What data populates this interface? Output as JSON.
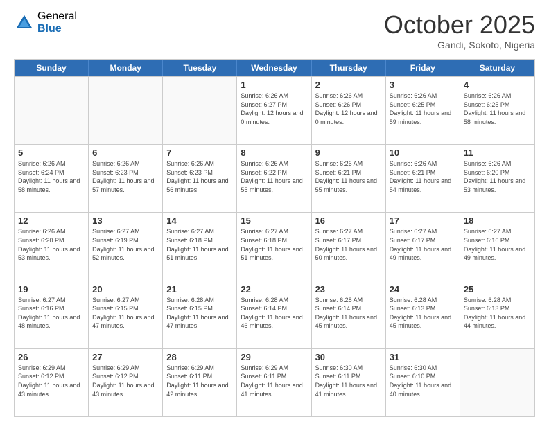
{
  "logo": {
    "general": "General",
    "blue": "Blue"
  },
  "header": {
    "month": "October 2025",
    "location": "Gandi, Sokoto, Nigeria"
  },
  "weekdays": [
    "Sunday",
    "Monday",
    "Tuesday",
    "Wednesday",
    "Thursday",
    "Friday",
    "Saturday"
  ],
  "weeks": [
    [
      {
        "day": "",
        "sunrise": "",
        "sunset": "",
        "daylight": "",
        "empty": true
      },
      {
        "day": "",
        "sunrise": "",
        "sunset": "",
        "daylight": "",
        "empty": true
      },
      {
        "day": "",
        "sunrise": "",
        "sunset": "",
        "daylight": "",
        "empty": true
      },
      {
        "day": "1",
        "sunrise": "Sunrise: 6:26 AM",
        "sunset": "Sunset: 6:27 PM",
        "daylight": "Daylight: 12 hours and 0 minutes."
      },
      {
        "day": "2",
        "sunrise": "Sunrise: 6:26 AM",
        "sunset": "Sunset: 6:26 PM",
        "daylight": "Daylight: 12 hours and 0 minutes."
      },
      {
        "day": "3",
        "sunrise": "Sunrise: 6:26 AM",
        "sunset": "Sunset: 6:25 PM",
        "daylight": "Daylight: 11 hours and 59 minutes."
      },
      {
        "day": "4",
        "sunrise": "Sunrise: 6:26 AM",
        "sunset": "Sunset: 6:25 PM",
        "daylight": "Daylight: 11 hours and 58 minutes."
      }
    ],
    [
      {
        "day": "5",
        "sunrise": "Sunrise: 6:26 AM",
        "sunset": "Sunset: 6:24 PM",
        "daylight": "Daylight: 11 hours and 58 minutes."
      },
      {
        "day": "6",
        "sunrise": "Sunrise: 6:26 AM",
        "sunset": "Sunset: 6:23 PM",
        "daylight": "Daylight: 11 hours and 57 minutes."
      },
      {
        "day": "7",
        "sunrise": "Sunrise: 6:26 AM",
        "sunset": "Sunset: 6:23 PM",
        "daylight": "Daylight: 11 hours and 56 minutes."
      },
      {
        "day": "8",
        "sunrise": "Sunrise: 6:26 AM",
        "sunset": "Sunset: 6:22 PM",
        "daylight": "Daylight: 11 hours and 55 minutes."
      },
      {
        "day": "9",
        "sunrise": "Sunrise: 6:26 AM",
        "sunset": "Sunset: 6:21 PM",
        "daylight": "Daylight: 11 hours and 55 minutes."
      },
      {
        "day": "10",
        "sunrise": "Sunrise: 6:26 AM",
        "sunset": "Sunset: 6:21 PM",
        "daylight": "Daylight: 11 hours and 54 minutes."
      },
      {
        "day": "11",
        "sunrise": "Sunrise: 6:26 AM",
        "sunset": "Sunset: 6:20 PM",
        "daylight": "Daylight: 11 hours and 53 minutes."
      }
    ],
    [
      {
        "day": "12",
        "sunrise": "Sunrise: 6:26 AM",
        "sunset": "Sunset: 6:20 PM",
        "daylight": "Daylight: 11 hours and 53 minutes."
      },
      {
        "day": "13",
        "sunrise": "Sunrise: 6:27 AM",
        "sunset": "Sunset: 6:19 PM",
        "daylight": "Daylight: 11 hours and 52 minutes."
      },
      {
        "day": "14",
        "sunrise": "Sunrise: 6:27 AM",
        "sunset": "Sunset: 6:18 PM",
        "daylight": "Daylight: 11 hours and 51 minutes."
      },
      {
        "day": "15",
        "sunrise": "Sunrise: 6:27 AM",
        "sunset": "Sunset: 6:18 PM",
        "daylight": "Daylight: 11 hours and 51 minutes."
      },
      {
        "day": "16",
        "sunrise": "Sunrise: 6:27 AM",
        "sunset": "Sunset: 6:17 PM",
        "daylight": "Daylight: 11 hours and 50 minutes."
      },
      {
        "day": "17",
        "sunrise": "Sunrise: 6:27 AM",
        "sunset": "Sunset: 6:17 PM",
        "daylight": "Daylight: 11 hours and 49 minutes."
      },
      {
        "day": "18",
        "sunrise": "Sunrise: 6:27 AM",
        "sunset": "Sunset: 6:16 PM",
        "daylight": "Daylight: 11 hours and 49 minutes."
      }
    ],
    [
      {
        "day": "19",
        "sunrise": "Sunrise: 6:27 AM",
        "sunset": "Sunset: 6:16 PM",
        "daylight": "Daylight: 11 hours and 48 minutes."
      },
      {
        "day": "20",
        "sunrise": "Sunrise: 6:27 AM",
        "sunset": "Sunset: 6:15 PM",
        "daylight": "Daylight: 11 hours and 47 minutes."
      },
      {
        "day": "21",
        "sunrise": "Sunrise: 6:28 AM",
        "sunset": "Sunset: 6:15 PM",
        "daylight": "Daylight: 11 hours and 47 minutes."
      },
      {
        "day": "22",
        "sunrise": "Sunrise: 6:28 AM",
        "sunset": "Sunset: 6:14 PM",
        "daylight": "Daylight: 11 hours and 46 minutes."
      },
      {
        "day": "23",
        "sunrise": "Sunrise: 6:28 AM",
        "sunset": "Sunset: 6:14 PM",
        "daylight": "Daylight: 11 hours and 45 minutes."
      },
      {
        "day": "24",
        "sunrise": "Sunrise: 6:28 AM",
        "sunset": "Sunset: 6:13 PM",
        "daylight": "Daylight: 11 hours and 45 minutes."
      },
      {
        "day": "25",
        "sunrise": "Sunrise: 6:28 AM",
        "sunset": "Sunset: 6:13 PM",
        "daylight": "Daylight: 11 hours and 44 minutes."
      }
    ],
    [
      {
        "day": "26",
        "sunrise": "Sunrise: 6:29 AM",
        "sunset": "Sunset: 6:12 PM",
        "daylight": "Daylight: 11 hours and 43 minutes."
      },
      {
        "day": "27",
        "sunrise": "Sunrise: 6:29 AM",
        "sunset": "Sunset: 6:12 PM",
        "daylight": "Daylight: 11 hours and 43 minutes."
      },
      {
        "day": "28",
        "sunrise": "Sunrise: 6:29 AM",
        "sunset": "Sunset: 6:11 PM",
        "daylight": "Daylight: 11 hours and 42 minutes."
      },
      {
        "day": "29",
        "sunrise": "Sunrise: 6:29 AM",
        "sunset": "Sunset: 6:11 PM",
        "daylight": "Daylight: 11 hours and 41 minutes."
      },
      {
        "day": "30",
        "sunrise": "Sunrise: 6:30 AM",
        "sunset": "Sunset: 6:11 PM",
        "daylight": "Daylight: 11 hours and 41 minutes."
      },
      {
        "day": "31",
        "sunrise": "Sunrise: 6:30 AM",
        "sunset": "Sunset: 6:10 PM",
        "daylight": "Daylight: 11 hours and 40 minutes."
      },
      {
        "day": "",
        "sunrise": "",
        "sunset": "",
        "daylight": "",
        "empty": true
      }
    ]
  ]
}
